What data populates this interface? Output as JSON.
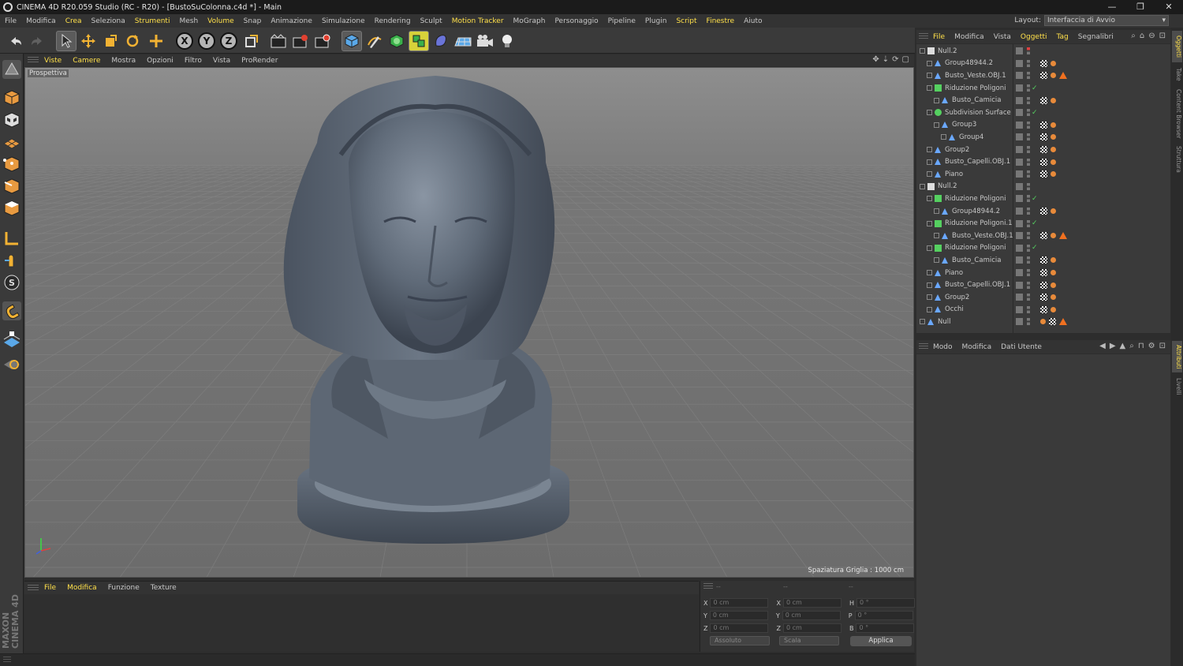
{
  "window": {
    "title": "CINEMA 4D R20.059 Studio (RC - R20) - [BustoSuColonna.c4d *] - Main",
    "controls": [
      "—",
      "❐",
      "✕"
    ]
  },
  "menubar": {
    "items": [
      "File",
      "Modifica",
      "Crea",
      "Seleziona",
      "Strumenti",
      "Mesh",
      "Volume",
      "Snap",
      "Animazione",
      "Simulazione",
      "Rendering",
      "Sculpt",
      "Motion Tracker",
      "MoGraph",
      "Personaggio",
      "Pipeline",
      "Plugin",
      "Script",
      "Finestre",
      "Aiuto"
    ],
    "highlighted": [
      "Strumenti",
      "Volume",
      "Motion Tracker",
      "Script",
      "Finestre",
      "Crea"
    ],
    "layout_label": "Layout:",
    "layout_value": "Interfaccia di Avvio"
  },
  "toolbar": {
    "axis_x": "X",
    "axis_y": "Y",
    "axis_z": "Z"
  },
  "viewport": {
    "menu": [
      "Viste",
      "Camere",
      "Mostra",
      "Opzioni",
      "Filtro",
      "Vista",
      "ProRender"
    ],
    "camera_label": "Prospettiva",
    "grid_spacing": "Spaziatura Griglia : 1000 cm"
  },
  "timeline": {
    "menu": [
      "File",
      "Modifica",
      "Funzione",
      "Texture"
    ]
  },
  "coords": {
    "headers": [
      "--",
      "--",
      "--"
    ],
    "rows": [
      {
        "a": "X",
        "av": "0 cm",
        "b": "X",
        "bv": "0 cm",
        "c": "H",
        "cv": "0 °"
      },
      {
        "a": "Y",
        "av": "0 cm",
        "b": "Y",
        "bv": "0 cm",
        "c": "P",
        "cv": "0 °"
      },
      {
        "a": "Z",
        "av": "0 cm",
        "b": "Z",
        "bv": "0 cm",
        "c": "B",
        "cv": "0 °"
      }
    ],
    "mode1": "Assoluto",
    "mode2": "Scala",
    "apply": "Applica"
  },
  "logo": "MAXON CINEMA 4D",
  "object_manager": {
    "menu": [
      "File",
      "Modifica",
      "Vista",
      "Oggetti",
      "Tag",
      "Segnalibri"
    ],
    "highlighted": [
      "File",
      "Oggetti",
      "Tag"
    ],
    "objects": [
      {
        "name": "Null.2",
        "indent": 0,
        "type": "null",
        "tags": []
      },
      {
        "name": "Group48944.2",
        "indent": 1,
        "type": "poly",
        "tags": [
          "chk",
          "dot"
        ]
      },
      {
        "name": "Busto_Veste.OBJ.1",
        "indent": 1,
        "type": "poly",
        "tags": [
          "chk",
          "dot",
          "tri"
        ]
      },
      {
        "name": "Riduzione Poligoni",
        "indent": 1,
        "type": "gen",
        "tags": []
      },
      {
        "name": "Busto_Camicia",
        "indent": 2,
        "type": "poly",
        "tags": [
          "chk",
          "dot"
        ]
      },
      {
        "name": "Subdivision Surface",
        "indent": 1,
        "type": "subd",
        "tags": []
      },
      {
        "name": "Group3",
        "indent": 2,
        "type": "poly",
        "tags": [
          "chk",
          "dot"
        ]
      },
      {
        "name": "Group4",
        "indent": 3,
        "type": "poly",
        "tags": [
          "chk",
          "dot"
        ]
      },
      {
        "name": "Group2",
        "indent": 1,
        "type": "poly",
        "tags": [
          "chk",
          "dot"
        ]
      },
      {
        "name": "Busto_Capelli.OBJ.1",
        "indent": 1,
        "type": "poly",
        "tags": [
          "chk",
          "dot"
        ]
      },
      {
        "name": "Piano",
        "indent": 1,
        "type": "poly",
        "tags": [
          "chk",
          "dot"
        ]
      },
      {
        "name": "Null.2",
        "indent": 0,
        "type": "null",
        "tags": []
      },
      {
        "name": "Riduzione Poligoni",
        "indent": 1,
        "type": "gen",
        "tags": []
      },
      {
        "name": "Group48944.2",
        "indent": 2,
        "type": "poly",
        "tags": [
          "chk",
          "dot"
        ]
      },
      {
        "name": "Riduzione Poligoni.1",
        "indent": 1,
        "type": "gen",
        "tags": []
      },
      {
        "name": "Busto_Veste.OBJ.1",
        "indent": 2,
        "type": "poly",
        "tags": [
          "chk",
          "dot",
          "tri"
        ]
      },
      {
        "name": "Riduzione Poligoni",
        "indent": 1,
        "type": "gen",
        "tags": []
      },
      {
        "name": "Busto_Camicia",
        "indent": 2,
        "type": "poly",
        "tags": [
          "chk",
          "dot"
        ]
      },
      {
        "name": "Piano",
        "indent": 1,
        "type": "poly",
        "tags": [
          "chk",
          "dot"
        ]
      },
      {
        "name": "Busto_Capelli.OBJ.1",
        "indent": 1,
        "type": "poly",
        "tags": [
          "chk",
          "dot"
        ]
      },
      {
        "name": "Group2",
        "indent": 1,
        "type": "poly",
        "tags": [
          "chk",
          "dot"
        ]
      },
      {
        "name": "Occhi",
        "indent": 1,
        "type": "poly",
        "tags": [
          "chk",
          "dot"
        ]
      },
      {
        "name": "Null",
        "indent": 0,
        "type": "poly",
        "tags": [
          "dot",
          "chk",
          "tri"
        ]
      }
    ]
  },
  "attributes": {
    "menu": [
      "Modo",
      "Modifica",
      "Dati Utente"
    ]
  },
  "right_tabs": [
    "Oggetti",
    "Take",
    "Content Browser",
    "Struttura",
    "Attributi",
    "Livelli"
  ],
  "colors": {
    "accent": "#ffe04a",
    "model": "#5a6470",
    "tag_orange": "#f07020"
  }
}
